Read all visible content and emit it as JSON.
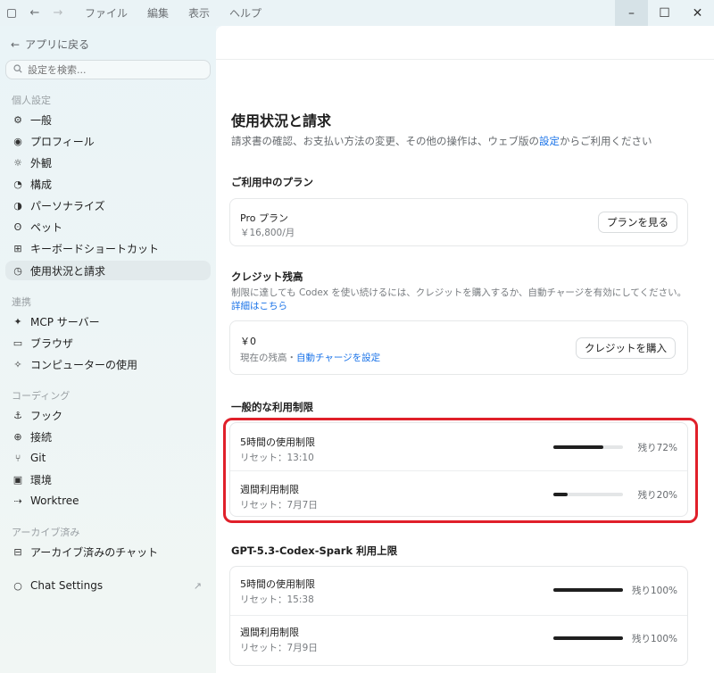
{
  "menu": [
    "ファイル",
    "編集",
    "表示",
    "ヘルプ"
  ],
  "window": {
    "minimize": "–",
    "maximize": "☐",
    "close": "✕"
  },
  "sidebar": {
    "back_label": "アプリに戻る",
    "search_placeholder": "設定を検索...",
    "sections": {
      "personal": "個人設定",
      "integrations": "連携",
      "coding": "コーディング",
      "archived": "アーカイブ済み"
    },
    "personal_items": [
      "一般",
      "プロフィール",
      "外観",
      "構成",
      "パーソナライズ",
      "ペット",
      "キーボードショートカット",
      "使用状況と請求"
    ],
    "integration_items": [
      "MCP サーバー",
      "ブラウザ",
      "コンピューターの使用"
    ],
    "coding_items": [
      "フック",
      "接続",
      "Git",
      "環境",
      "Worktree"
    ],
    "archived_items": [
      "アーカイブ済みのチャット"
    ],
    "chat_settings": "Chat Settings",
    "active_item": "使用状況と請求"
  },
  "main": {
    "title": "使用状況と請求",
    "desc_before": "請求書の確認、お支払い方法の変更、その他の操作は、ウェブ版の",
    "desc_link": "設定",
    "desc_after": "からご利用ください",
    "plan": {
      "heading": "ご利用中のプラン",
      "name": "Pro プラン",
      "price": "￥16,800/月",
      "button": "プランを見る"
    },
    "credit": {
      "heading": "クレジット残高",
      "desc": "制限に達しても Codex を使い続けるには、クレジットを購入するか、自動チャージを有効にしてください。",
      "details_link": "詳細はこちら",
      "amount": "￥0",
      "sub_before": "現在の残高・",
      "sub_link": "自動チャージを設定",
      "button": "クレジットを購入"
    },
    "general_limits": {
      "heading": "一般的な利用制限",
      "rows": [
        {
          "title": "5時間の使用制限",
          "reset": "リセット：13:10",
          "remaining_label": "残り72%",
          "remaining": 0.72
        },
        {
          "title": "週間利用制限",
          "reset": "リセット：7月7日",
          "remaining_label": "残り20%",
          "remaining": 0.2
        }
      ]
    },
    "spark_limits": {
      "heading": "GPT-5.3-Codex-Spark 利用上限",
      "rows": [
        {
          "title": "5時間の使用制限",
          "reset": "リセット：15:38",
          "remaining_label": "残り100%",
          "remaining": 1.0
        },
        {
          "title": "週間利用制限",
          "reset": "リセット：7月9日",
          "remaining_label": "残り100%",
          "remaining": 1.0
        }
      ]
    }
  },
  "colors": {
    "link": "#1a73e8",
    "highlight": "#e0202a",
    "bar_fill": "#1f1f1f"
  }
}
